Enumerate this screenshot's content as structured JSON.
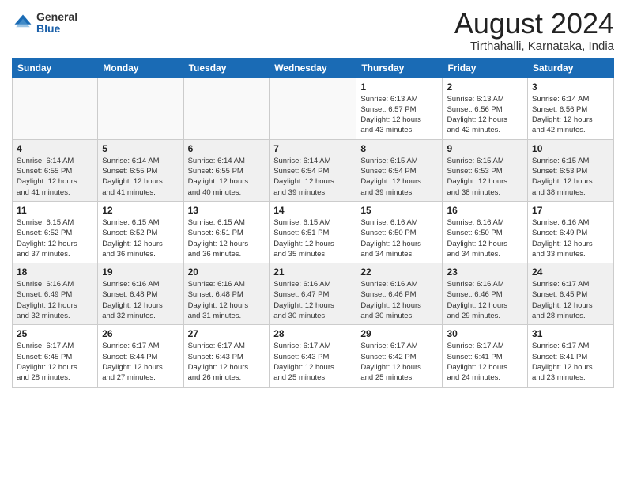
{
  "header": {
    "logo": {
      "general": "General",
      "blue": "Blue"
    },
    "title": "August 2024",
    "location": "Tirthahalli, Karnataka, India"
  },
  "calendar": {
    "days_of_week": [
      "Sunday",
      "Monday",
      "Tuesday",
      "Wednesday",
      "Thursday",
      "Friday",
      "Saturday"
    ],
    "weeks": [
      [
        {
          "day": "",
          "info": ""
        },
        {
          "day": "",
          "info": ""
        },
        {
          "day": "",
          "info": ""
        },
        {
          "day": "",
          "info": ""
        },
        {
          "day": "1",
          "info": "Sunrise: 6:13 AM\nSunset: 6:57 PM\nDaylight: 12 hours\nand 43 minutes."
        },
        {
          "day": "2",
          "info": "Sunrise: 6:13 AM\nSunset: 6:56 PM\nDaylight: 12 hours\nand 42 minutes."
        },
        {
          "day": "3",
          "info": "Sunrise: 6:14 AM\nSunset: 6:56 PM\nDaylight: 12 hours\nand 42 minutes."
        }
      ],
      [
        {
          "day": "4",
          "info": "Sunrise: 6:14 AM\nSunset: 6:55 PM\nDaylight: 12 hours\nand 41 minutes."
        },
        {
          "day": "5",
          "info": "Sunrise: 6:14 AM\nSunset: 6:55 PM\nDaylight: 12 hours\nand 41 minutes."
        },
        {
          "day": "6",
          "info": "Sunrise: 6:14 AM\nSunset: 6:55 PM\nDaylight: 12 hours\nand 40 minutes."
        },
        {
          "day": "7",
          "info": "Sunrise: 6:14 AM\nSunset: 6:54 PM\nDaylight: 12 hours\nand 39 minutes."
        },
        {
          "day": "8",
          "info": "Sunrise: 6:15 AM\nSunset: 6:54 PM\nDaylight: 12 hours\nand 39 minutes."
        },
        {
          "day": "9",
          "info": "Sunrise: 6:15 AM\nSunset: 6:53 PM\nDaylight: 12 hours\nand 38 minutes."
        },
        {
          "day": "10",
          "info": "Sunrise: 6:15 AM\nSunset: 6:53 PM\nDaylight: 12 hours\nand 38 minutes."
        }
      ],
      [
        {
          "day": "11",
          "info": "Sunrise: 6:15 AM\nSunset: 6:52 PM\nDaylight: 12 hours\nand 37 minutes."
        },
        {
          "day": "12",
          "info": "Sunrise: 6:15 AM\nSunset: 6:52 PM\nDaylight: 12 hours\nand 36 minutes."
        },
        {
          "day": "13",
          "info": "Sunrise: 6:15 AM\nSunset: 6:51 PM\nDaylight: 12 hours\nand 36 minutes."
        },
        {
          "day": "14",
          "info": "Sunrise: 6:15 AM\nSunset: 6:51 PM\nDaylight: 12 hours\nand 35 minutes."
        },
        {
          "day": "15",
          "info": "Sunrise: 6:16 AM\nSunset: 6:50 PM\nDaylight: 12 hours\nand 34 minutes."
        },
        {
          "day": "16",
          "info": "Sunrise: 6:16 AM\nSunset: 6:50 PM\nDaylight: 12 hours\nand 34 minutes."
        },
        {
          "day": "17",
          "info": "Sunrise: 6:16 AM\nSunset: 6:49 PM\nDaylight: 12 hours\nand 33 minutes."
        }
      ],
      [
        {
          "day": "18",
          "info": "Sunrise: 6:16 AM\nSunset: 6:49 PM\nDaylight: 12 hours\nand 32 minutes."
        },
        {
          "day": "19",
          "info": "Sunrise: 6:16 AM\nSunset: 6:48 PM\nDaylight: 12 hours\nand 32 minutes."
        },
        {
          "day": "20",
          "info": "Sunrise: 6:16 AM\nSunset: 6:48 PM\nDaylight: 12 hours\nand 31 minutes."
        },
        {
          "day": "21",
          "info": "Sunrise: 6:16 AM\nSunset: 6:47 PM\nDaylight: 12 hours\nand 30 minutes."
        },
        {
          "day": "22",
          "info": "Sunrise: 6:16 AM\nSunset: 6:46 PM\nDaylight: 12 hours\nand 30 minutes."
        },
        {
          "day": "23",
          "info": "Sunrise: 6:16 AM\nSunset: 6:46 PM\nDaylight: 12 hours\nand 29 minutes."
        },
        {
          "day": "24",
          "info": "Sunrise: 6:17 AM\nSunset: 6:45 PM\nDaylight: 12 hours\nand 28 minutes."
        }
      ],
      [
        {
          "day": "25",
          "info": "Sunrise: 6:17 AM\nSunset: 6:45 PM\nDaylight: 12 hours\nand 28 minutes."
        },
        {
          "day": "26",
          "info": "Sunrise: 6:17 AM\nSunset: 6:44 PM\nDaylight: 12 hours\nand 27 minutes."
        },
        {
          "day": "27",
          "info": "Sunrise: 6:17 AM\nSunset: 6:43 PM\nDaylight: 12 hours\nand 26 minutes."
        },
        {
          "day": "28",
          "info": "Sunrise: 6:17 AM\nSunset: 6:43 PM\nDaylight: 12 hours\nand 25 minutes."
        },
        {
          "day": "29",
          "info": "Sunrise: 6:17 AM\nSunset: 6:42 PM\nDaylight: 12 hours\nand 25 minutes."
        },
        {
          "day": "30",
          "info": "Sunrise: 6:17 AM\nSunset: 6:41 PM\nDaylight: 12 hours\nand 24 minutes."
        },
        {
          "day": "31",
          "info": "Sunrise: 6:17 AM\nSunset: 6:41 PM\nDaylight: 12 hours\nand 23 minutes."
        }
      ]
    ]
  }
}
